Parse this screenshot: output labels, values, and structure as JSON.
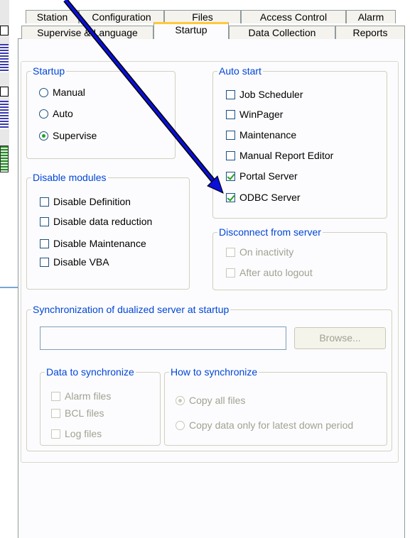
{
  "tabs_row1": [
    {
      "label": "Station"
    },
    {
      "label": "Configuration"
    },
    {
      "label": "Files"
    },
    {
      "label": "Access Control"
    },
    {
      "label": "Alarm"
    }
  ],
  "tabs_row2": [
    {
      "label": "Supervise & Language"
    },
    {
      "label": "Startup",
      "active": true
    },
    {
      "label": "Data Collection"
    },
    {
      "label": "Reports"
    }
  ],
  "startup_group": {
    "title": "Startup",
    "options": [
      {
        "label": "Manual",
        "checked": false
      },
      {
        "label": "Auto",
        "checked": false
      },
      {
        "label": "Supervise",
        "checked": true
      }
    ]
  },
  "disable_modules_group": {
    "title": "Disable modules",
    "options": [
      {
        "label": "Disable Definition",
        "checked": false
      },
      {
        "label": "Disable data reduction",
        "checked": false
      },
      {
        "label": "Disable Maintenance",
        "checked": false
      },
      {
        "label": "Disable VBA",
        "checked": false
      }
    ]
  },
  "auto_start_group": {
    "title": "Auto start",
    "options": [
      {
        "label": "Job Scheduler",
        "checked": false
      },
      {
        "label": "WinPager",
        "checked": false
      },
      {
        "label": "Maintenance",
        "checked": false
      },
      {
        "label": "Manual Report Editor",
        "checked": false
      },
      {
        "label": "Portal Server",
        "checked": true
      },
      {
        "label": "ODBC Server",
        "checked": true
      }
    ]
  },
  "disconnect_group": {
    "title": "Disconnect from server",
    "options": [
      {
        "label": "On inactivity",
        "checked": false
      },
      {
        "label": "After auto logout",
        "checked": false
      }
    ]
  },
  "sync_group": {
    "title": "Synchronization of dualized server at startup",
    "path_value": "",
    "browse_label": "Browse...",
    "data_to_sync": {
      "title": "Data to synchronize",
      "options": [
        {
          "label": "Alarm files",
          "checked": false
        },
        {
          "label": "BCL files",
          "checked": false
        },
        {
          "label": "Log files",
          "checked": false
        }
      ]
    },
    "how_to_sync": {
      "title": "How to synchronize",
      "options": [
        {
          "label": "Copy all files",
          "checked": true
        },
        {
          "label": "Copy data only for latest down period",
          "checked": false
        }
      ]
    }
  },
  "colors": {
    "annotation_arrow": "#0a10d8",
    "group_title": "#0046d5",
    "active_tab_accent": "#ffc83c",
    "check_mark": "#21a121"
  }
}
